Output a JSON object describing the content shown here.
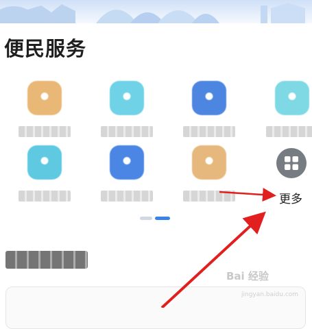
{
  "section_title": "便民服务",
  "more": {
    "label": "更多",
    "icon": "grid-icon"
  },
  "services": [
    {
      "label": "",
      "color": "#e9b877",
      "icon": "service-icon"
    },
    {
      "label": "",
      "color": "#6fd2e6",
      "icon": "service-icon"
    },
    {
      "label": "",
      "color": "#4d86e0",
      "icon": "service-icon"
    },
    {
      "label": "",
      "color": "#7fd9e4",
      "icon": "service-icon"
    },
    {
      "label": "",
      "color": "#5fc9e2",
      "icon": "service-icon"
    },
    {
      "label": "",
      "color": "#4b86e4",
      "icon": "service-icon"
    },
    {
      "label": "",
      "color": "#e6b87e",
      "icon": "service-icon"
    }
  ],
  "section2_title": "",
  "watermark": {
    "brand": "Bai 经验",
    "url": "jingyan.baidu.com"
  },
  "colors": {
    "accent": "#3b82e8",
    "annotation": "#e11f1f",
    "more_button": "#777b82"
  }
}
